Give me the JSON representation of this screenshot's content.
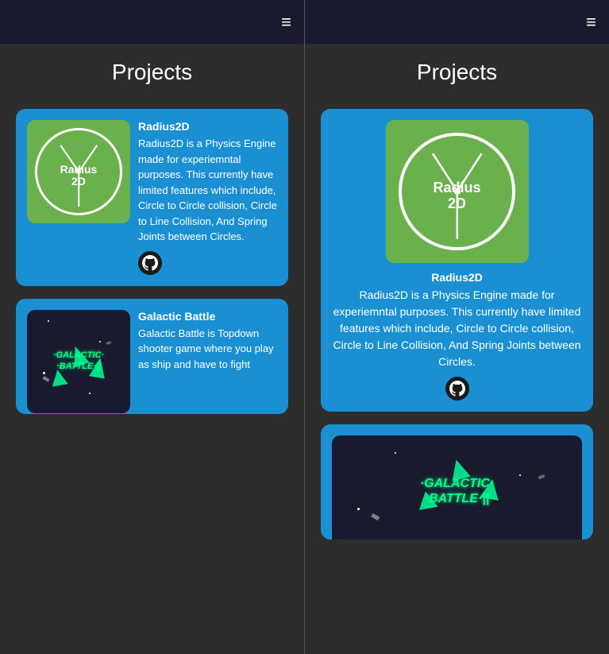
{
  "panels": [
    {
      "id": "left",
      "topbar": {
        "hamburger": "≡"
      },
      "title": "Projects",
      "projects": [
        {
          "id": "radius2d",
          "name": "Radius2D",
          "description": "Radius2D is a Physics Engine made for experiemntal purposes. This currently have limited features which include, Circle to Circle collision, Circle to Line Collision, And Spring Joints between Circles.",
          "layout": "row",
          "github": true
        },
        {
          "id": "galactic-battle",
          "name": "Galactic Battle",
          "description": "Galactic Battle is Topdown shooter game where you play as ship and have to fight",
          "layout": "row",
          "github": false
        }
      ]
    },
    {
      "id": "right",
      "topbar": {
        "hamburger": "≡"
      },
      "title": "Projects",
      "projects": [
        {
          "id": "radius2d-wide",
          "name": "Radius2D",
          "description": "Radius2D is a Physics Engine made for experiemntal purposes. This currently have limited features which include, Circle to Circle collision, Circle to Line Collision, And Spring Joints between Circles.",
          "layout": "wide",
          "github": true
        },
        {
          "id": "galactic-battle-wide",
          "name": "Galactic Battle",
          "description": "",
          "layout": "wide",
          "github": false
        }
      ]
    }
  ]
}
